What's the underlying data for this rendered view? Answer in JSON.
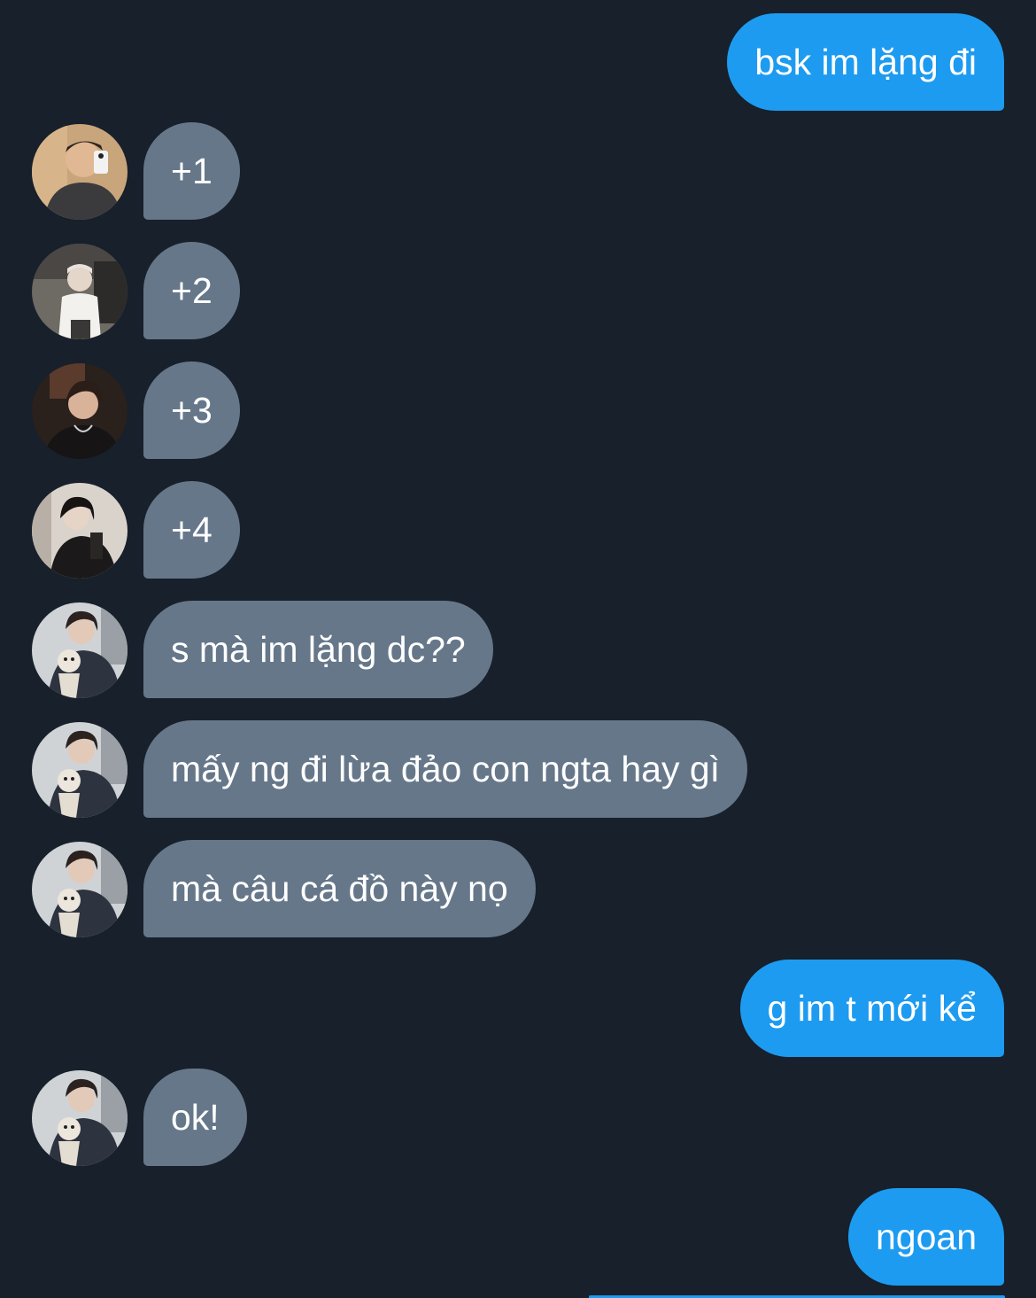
{
  "messages": [
    {
      "side": "sent",
      "text": "bsk im lặng đi"
    },
    {
      "side": "received",
      "text": "+1",
      "avatar": "user-avatar-1"
    },
    {
      "side": "received",
      "text": "+2",
      "avatar": "user-avatar-2"
    },
    {
      "side": "received",
      "text": "+3",
      "avatar": "user-avatar-3"
    },
    {
      "side": "received",
      "text": "+4",
      "avatar": "user-avatar-4"
    },
    {
      "side": "received",
      "text": "s mà im lặng dc??",
      "avatar": "user-avatar-5"
    },
    {
      "side": "received",
      "text": "mấy ng đi lừa đảo con ngta hay gì",
      "avatar": "user-avatar-5"
    },
    {
      "side": "received",
      "text": "mà câu cá đồ này nọ",
      "avatar": "user-avatar-5"
    },
    {
      "side": "sent",
      "text": "g im t mới kể"
    },
    {
      "side": "received",
      "text": "ok!",
      "avatar": "user-avatar-5"
    },
    {
      "side": "sent",
      "text": "ngoan"
    }
  ],
  "colors": {
    "background": "#17202b",
    "sent_bubble": "#1d9bf0",
    "received_bubble": "#66778a",
    "text": "#ffffff"
  }
}
